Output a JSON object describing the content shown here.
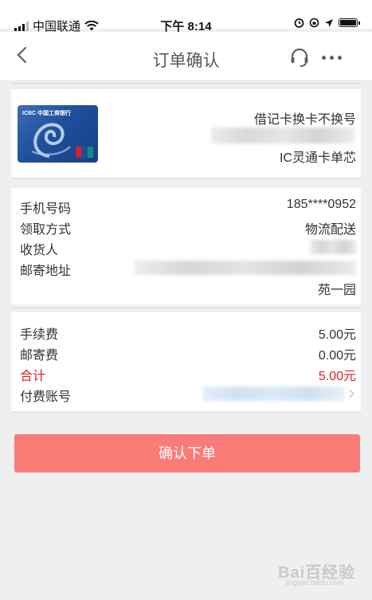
{
  "status_bar": {
    "carrier": "中国联通",
    "time": "下午 8:14",
    "icons": [
      "signal-icon",
      "wifi-icon",
      "alarm-icon",
      "rotation-lock-icon",
      "location-icon",
      "battery-icon"
    ]
  },
  "nav": {
    "title": "订单确认",
    "icons": [
      "back-chevron-icon",
      "headset-icon",
      "more-dots-icon"
    ]
  },
  "card": {
    "bank_logo_text": "ICBC 中国工商银行",
    "name": "借记卡换卡不换号",
    "type": "IC灵通卡单芯"
  },
  "info": {
    "rows": [
      {
        "label": "手机号码",
        "value": "185****0952"
      },
      {
        "label": "领取方式",
        "value": "物流配送"
      },
      {
        "label": "收货人",
        "value": ""
      },
      {
        "label": "邮寄地址",
        "value": ""
      }
    ],
    "address_line2": "苑一园"
  },
  "fees": {
    "rows": [
      {
        "label": "手续费",
        "value": "5.00元"
      },
      {
        "label": "邮寄费",
        "value": "0.00元"
      }
    ],
    "total_label": "合计",
    "total_value": "5.00元",
    "account_label": "付费账号"
  },
  "confirm_label": "确认下单",
  "watermark": {
    "text": "Bai百经验",
    "url": "jingyan.baidu.com"
  },
  "colors": {
    "accent_button": "#fb7b78",
    "total_red": "#e0202a",
    "background": "#efefef",
    "nav_title": "#555a60"
  }
}
